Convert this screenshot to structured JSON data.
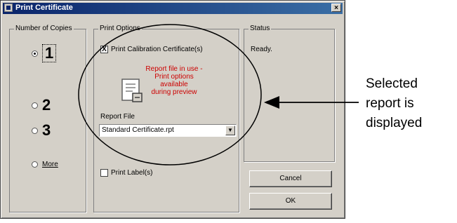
{
  "dialog": {
    "title": "Print Certificate",
    "close_label": "×"
  },
  "copies": {
    "legend": "Number of Copies",
    "options": [
      {
        "label": "1",
        "selected": true
      },
      {
        "label": "2",
        "selected": false
      },
      {
        "label": "3",
        "selected": false
      },
      {
        "label": "More",
        "selected": false
      }
    ]
  },
  "print_options": {
    "legend": "Print Options",
    "calibration_checkbox": {
      "label": "Print Calibration Certificate(s)",
      "checked": true,
      "mark": "X"
    },
    "warning_lines": [
      "Report file in use -",
      "Print options available",
      "during preview"
    ],
    "report_file_label": "Report File",
    "report_file_value": "Standard Certificate.rpt",
    "labels_checkbox": {
      "label": "Print Label(s)",
      "checked": false,
      "mark": ""
    }
  },
  "status": {
    "legend": "Status",
    "text": "Ready."
  },
  "buttons": {
    "cancel": "Cancel",
    "ok": "OK"
  },
  "annotation": {
    "lines": [
      "Selected",
      "report is",
      "displayed"
    ]
  },
  "colors": {
    "warning": "#cc0000",
    "title_bar": "#0a246a",
    "dialog_bg": "#d4d0c8"
  }
}
